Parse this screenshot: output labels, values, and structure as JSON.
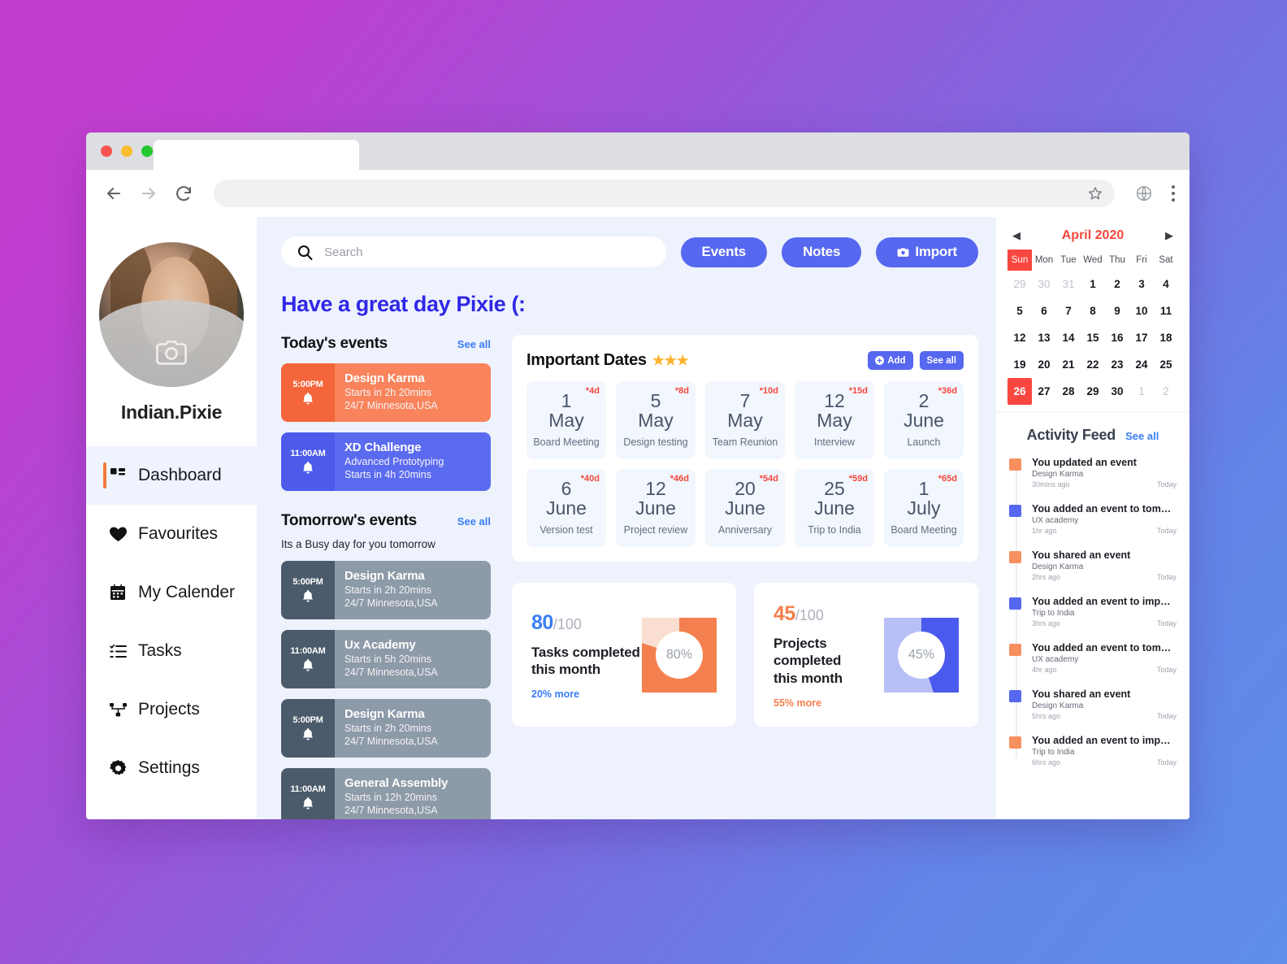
{
  "browser": {
    "back_icon": "back-arrow-icon",
    "forward_icon": "forward-arrow-icon",
    "reload_icon": "reload-icon",
    "url_value": "",
    "bookmark_icon": "star-icon",
    "globe_icon": "globe-icon",
    "menu_icon": "kebab-menu-icon"
  },
  "sidebar": {
    "username": "Indian.Pixie",
    "avatar_camera_icon": "camera-icon",
    "items": [
      {
        "label": "Dashboard",
        "icon": "dashboard-icon",
        "active": true
      },
      {
        "label": "Favourites",
        "icon": "heart-icon",
        "active": false
      },
      {
        "label": "My Calender",
        "icon": "calendar-icon",
        "active": false
      },
      {
        "label": "Tasks",
        "icon": "list-icon",
        "active": false
      },
      {
        "label": "Projects",
        "icon": "sitemap-icon",
        "active": false
      },
      {
        "label": "Settings",
        "icon": "gear-icon",
        "active": false
      }
    ]
  },
  "topbar": {
    "search_placeholder": "Search",
    "search_value": "",
    "search_icon": "search-icon",
    "events_label": "Events",
    "notes_label": "Notes",
    "import_label": "Import",
    "import_icon": "camera-icon"
  },
  "greeting": "Have a great day Pixie (:",
  "today": {
    "title": "Today's events",
    "see_all": "See all",
    "events": [
      {
        "time": "5:00PM",
        "title": "Design Karma",
        "line1": "Starts in 2h 20mins",
        "line2": "24/7 Minnesota,USA",
        "color": "orange"
      },
      {
        "time": "11:00AM",
        "title": "XD Challenge",
        "line1": "Advanced Prototyping",
        "line2": "Starts in 4h 20mins",
        "color": "blue"
      }
    ]
  },
  "tomorrow": {
    "title": "Tomorrow's events",
    "see_all": "See all",
    "subtitle": "Its a Busy day for you tomorrow",
    "events": [
      {
        "time": "5:00PM",
        "title": "Design Karma",
        "line1": "Starts in 2h 20mins",
        "line2": "24/7 Minnesota,USA",
        "color": "gray"
      },
      {
        "time": "11:00AM",
        "title": "Ux Academy",
        "line1": "Starts in 5h 20mins",
        "line2": "24/7 Minnesota,USA",
        "color": "gray"
      },
      {
        "time": "5:00PM",
        "title": "Design Karma",
        "line1": "Starts in 2h 20mins",
        "line2": "24/7 Minnesota,USA",
        "color": "gray"
      },
      {
        "time": "11:00AM",
        "title": "General Assembly",
        "line1": "Starts in 12h 20mins",
        "line2": "24/7 Minnesota,USA",
        "color": "gray"
      }
    ]
  },
  "important_dates": {
    "title": "Important Dates",
    "stars": "★★★",
    "add_label": "Add",
    "add_icon": "plus-circle-icon",
    "see_all": "See all",
    "cells": [
      {
        "day": "1",
        "month": "May",
        "label": "Board Meeting",
        "badge": "*4d"
      },
      {
        "day": "5",
        "month": "May",
        "label": "Design testing",
        "badge": "*8d"
      },
      {
        "day": "7",
        "month": "May",
        "label": "Team Reunion",
        "badge": "*10d"
      },
      {
        "day": "12",
        "month": "May",
        "label": "Interview",
        "badge": "*15d"
      },
      {
        "day": "2",
        "month": "June",
        "label": "Launch",
        "badge": "*36d"
      },
      {
        "day": "6",
        "month": "June",
        "label": "Version test",
        "badge": "*40d"
      },
      {
        "day": "12",
        "month": "June",
        "label": "Project review",
        "badge": "*46d"
      },
      {
        "day": "20",
        "month": "June",
        "label": "Anniversary",
        "badge": "*54d"
      },
      {
        "day": "25",
        "month": "June",
        "label": "Trip to India",
        "badge": "*59d"
      },
      {
        "day": "1",
        "month": "July",
        "label": "Board Meeting",
        "badge": "*65d"
      }
    ]
  },
  "chart_data": [
    {
      "type": "pie",
      "title": "Tasks completed this month",
      "value": 80,
      "max": 100,
      "center_label": "80%",
      "numerator": "80",
      "denominator": "/100",
      "footnote": "20% more",
      "color": "#f5804f",
      "track_color": "#fbded2",
      "num_color": "#3a7ef5",
      "foot_color": "#3a7ef5"
    },
    {
      "type": "pie",
      "title": "Projects completed this month",
      "value": 45,
      "max": 100,
      "center_label": "45%",
      "numerator": "45",
      "denominator": "/100",
      "footnote": "55% more",
      "color": "#4a5aec",
      "track_color": "#b7bff6",
      "num_color": "#f5804f",
      "foot_color": "#f5804f"
    }
  ],
  "calendar": {
    "month_title": "April 2020",
    "prev_icon": "chevron-left-icon",
    "next_icon": "chevron-right-icon",
    "dow": [
      "Sun",
      "Mon",
      "Tue",
      "Wed",
      "Thu",
      "Fri",
      "Sat"
    ],
    "weeks": [
      [
        {
          "d": "29",
          "m": true
        },
        {
          "d": "30",
          "m": true
        },
        {
          "d": "31",
          "m": true
        },
        {
          "d": "1"
        },
        {
          "d": "2"
        },
        {
          "d": "3"
        },
        {
          "d": "4"
        }
      ],
      [
        {
          "d": "5"
        },
        {
          "d": "6"
        },
        {
          "d": "7"
        },
        {
          "d": "8"
        },
        {
          "d": "9"
        },
        {
          "d": "10"
        },
        {
          "d": "11"
        }
      ],
      [
        {
          "d": "12"
        },
        {
          "d": "13"
        },
        {
          "d": "14"
        },
        {
          "d": "15"
        },
        {
          "d": "16"
        },
        {
          "d": "17"
        },
        {
          "d": "18"
        }
      ],
      [
        {
          "d": "19"
        },
        {
          "d": "20"
        },
        {
          "d": "21"
        },
        {
          "d": "22"
        },
        {
          "d": "23"
        },
        {
          "d": "24"
        },
        {
          "d": "25"
        }
      ],
      [
        {
          "d": "26",
          "s": true
        },
        {
          "d": "27"
        },
        {
          "d": "28"
        },
        {
          "d": "29"
        },
        {
          "d": "30"
        },
        {
          "d": "1",
          "m": true
        },
        {
          "d": "2",
          "m": true
        }
      ]
    ]
  },
  "activity": {
    "title": "Activity Feed",
    "see_all": "See all",
    "items": [
      {
        "title": "You updated an event",
        "sub": "Design Karma",
        "ago": "30mins ago",
        "day": "Today",
        "color": "#f7905f"
      },
      {
        "title": "You added an event  to tom…",
        "sub": "UX academy",
        "ago": "1hr ago",
        "day": "Today",
        "color": "#5667f0"
      },
      {
        "title": "You shared an event",
        "sub": "Design Karma",
        "ago": "2hrs ago",
        "day": "Today",
        "color": "#f7905f"
      },
      {
        "title": "You added an event to imp…",
        "sub": "Trip to India",
        "ago": "3hrs ago",
        "day": "Today",
        "color": "#5667f0"
      },
      {
        "title": "You added an event  to tom…",
        "sub": "UX academy",
        "ago": "4hr ago",
        "day": "Today",
        "color": "#f7905f"
      },
      {
        "title": "You shared an event",
        "sub": "Design Karma",
        "ago": "5hrs ago",
        "day": "Today",
        "color": "#5667f0"
      },
      {
        "title": "You added an event to imp…",
        "sub": "Trip to India",
        "ago": "6hrs ago",
        "day": "Today",
        "color": "#f7905f"
      }
    ]
  }
}
